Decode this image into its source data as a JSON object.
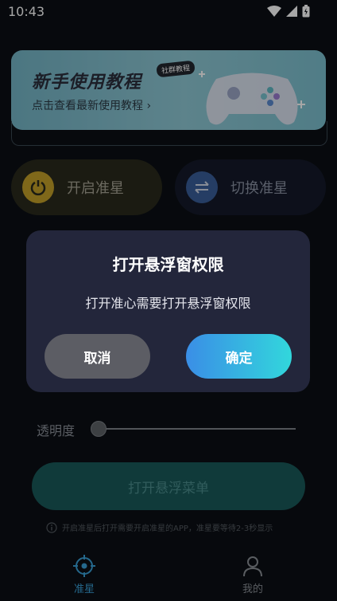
{
  "status_bar": {
    "time": "10:43"
  },
  "banner": {
    "title": "新手使用教程",
    "subtitle": "点击查看最新使用教程 ›",
    "badge": "社群教程"
  },
  "actions": {
    "enable_label": "开启准星",
    "switch_label": "切换准星"
  },
  "opacity": {
    "label": "透明度",
    "value": 0
  },
  "float_menu_button": "打开悬浮菜单",
  "tip": "开启准星后打开需要开启准星的APP，准星要等待2-3秒显示",
  "tabs": [
    {
      "label": "准星",
      "icon": "crosshair-icon"
    },
    {
      "label": "我的",
      "icon": "user-icon"
    }
  ],
  "dialog": {
    "title": "打开悬浮窗权限",
    "message": "打开准心需要打开悬浮窗权限",
    "cancel": "取消",
    "confirm": "确定"
  },
  "colors": {
    "background": "#0b0f14",
    "dialog": "#23263b",
    "confirm_gradient_start": "#3a8ee6",
    "confirm_gradient_end": "#32d7dc",
    "cancel": "#5c5d64"
  }
}
